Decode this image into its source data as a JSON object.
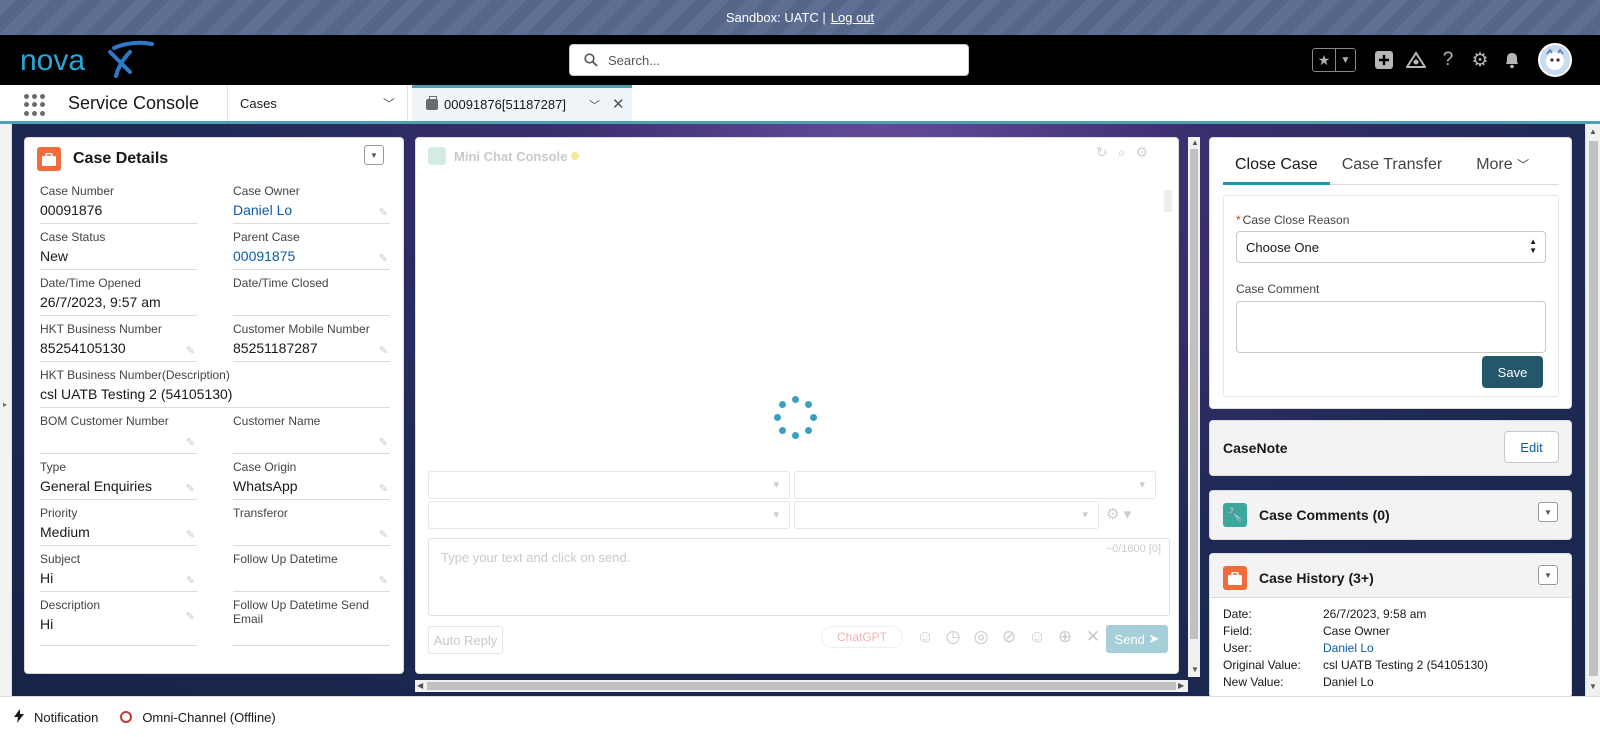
{
  "sandbox": {
    "label": "Sandbox: UATC |",
    "logout": "Log out"
  },
  "header": {
    "logo_text": "nova",
    "search_placeholder": "Search...",
    "icons": [
      "favorites-star-icon",
      "favorites-dropdown-icon",
      "add-icon",
      "trailhead-icon",
      "help-icon",
      "setup-gear-icon",
      "notifications-bell-icon",
      "user-avatar"
    ]
  },
  "nav": {
    "app_name": "Service Console",
    "object_select": "Cases",
    "workspace_tab": "00091876[51187287]"
  },
  "case_details": {
    "title": "Case Details",
    "fields": {
      "case_number": {
        "label": "Case Number",
        "value": "00091876"
      },
      "case_owner": {
        "label": "Case Owner",
        "value": "Daniel Lo"
      },
      "case_status": {
        "label": "Case Status",
        "value": "New"
      },
      "parent_case": {
        "label": "Parent Case",
        "value": "00091875"
      },
      "date_opened": {
        "label": "Date/Time Opened",
        "value": "26/7/2023, 9:57 am"
      },
      "date_closed": {
        "label": "Date/Time Closed",
        "value": ""
      },
      "hkt_business_number": {
        "label": "HKT Business Number",
        "value": "85254105130"
      },
      "customer_mobile": {
        "label": "Customer Mobile Number",
        "value": "85251187287"
      },
      "hkt_business_desc": {
        "label": "HKT Business Number(Description)",
        "value": "csl UATB Testing 2 (54105130)"
      },
      "bom_customer_number": {
        "label": "BOM Customer Number",
        "value": ""
      },
      "customer_name": {
        "label": "Customer Name",
        "value": ""
      },
      "type": {
        "label": "Type",
        "value": "General Enquiries"
      },
      "case_origin": {
        "label": "Case Origin",
        "value": "WhatsApp"
      },
      "priority": {
        "label": "Priority",
        "value": "Medium"
      },
      "transferor": {
        "label": "Transferor",
        "value": ""
      },
      "subject": {
        "label": "Subject",
        "value": "Hi"
      },
      "follow_up_datetime": {
        "label": "Follow Up Datetime",
        "value": ""
      },
      "description": {
        "label": "Description",
        "value": "Hi"
      },
      "follow_up_send_email": {
        "label": "Follow Up Datetime Send Email",
        "value": ""
      }
    }
  },
  "chat": {
    "title": "Mini Chat Console",
    "placeholder": "Type your text and click on send.",
    "char_count": "~0/1600 [0]",
    "auto_reply": "Auto Reply",
    "chatgpt": "ChatGPT",
    "send": "Send",
    "loading": true
  },
  "close_case": {
    "tabs": [
      "Close Case",
      "Case Transfer",
      "More"
    ],
    "active_tab": "Close Case",
    "reason_label": "Case Close Reason",
    "reason_value": "Choose One",
    "comment_label": "Case Comment",
    "comment_value": "",
    "save": "Save"
  },
  "casenote": {
    "title": "CaseNote",
    "edit": "Edit"
  },
  "case_comments": {
    "title": "Case Comments (0)"
  },
  "case_history": {
    "title": "Case History (3+)",
    "rows": [
      {
        "key": "Date:",
        "value": "26/7/2023, 9:58 am"
      },
      {
        "key": "Field:",
        "value": "Case Owner"
      },
      {
        "key": "User:",
        "value": "Daniel Lo"
      },
      {
        "key": "Original Value:",
        "value": "csl UATB Testing 2 (54105130)"
      },
      {
        "key": "New Value:",
        "value": "Daniel Lo"
      }
    ]
  },
  "utility": {
    "notification": "Notification",
    "omni_channel": "Omni-Channel (Offline)"
  },
  "colors": {
    "accent_teal": "#1b96ab",
    "save_button": "#24576b",
    "case_icon_orange": "#f26b3a",
    "comments_icon_teal": "#3ba89b",
    "link_blue": "#0b5cab"
  }
}
